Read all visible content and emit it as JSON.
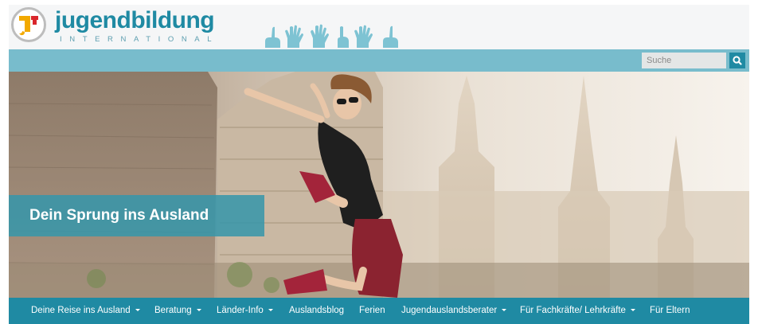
{
  "header": {
    "logo_text": "jugendbildung",
    "logo_tagline": "INTERNATIONAL"
  },
  "search": {
    "placeholder": "Suche",
    "button_icon": "search-icon"
  },
  "hero": {
    "caption": "Dein Sprung ins Ausland"
  },
  "nav": {
    "items": [
      {
        "label": "Deine Reise ins Ausland",
        "dropdown": true
      },
      {
        "label": "Beratung",
        "dropdown": true
      },
      {
        "label": "Länder-Info",
        "dropdown": true
      },
      {
        "label": "Auslandsblog",
        "dropdown": false
      },
      {
        "label": "Ferien",
        "dropdown": false
      },
      {
        "label": "Jugendauslandsberater",
        "dropdown": true
      },
      {
        "label": "Für Fachkräfte/ Lehrkräfte",
        "dropdown": true
      },
      {
        "label": "Für Eltern",
        "dropdown": false
      }
    ]
  },
  "colors": {
    "brand": "#1f8aa3",
    "searchbar": "#78bccc",
    "logo_red": "#d9262b",
    "logo_yellow": "#f2a900"
  }
}
